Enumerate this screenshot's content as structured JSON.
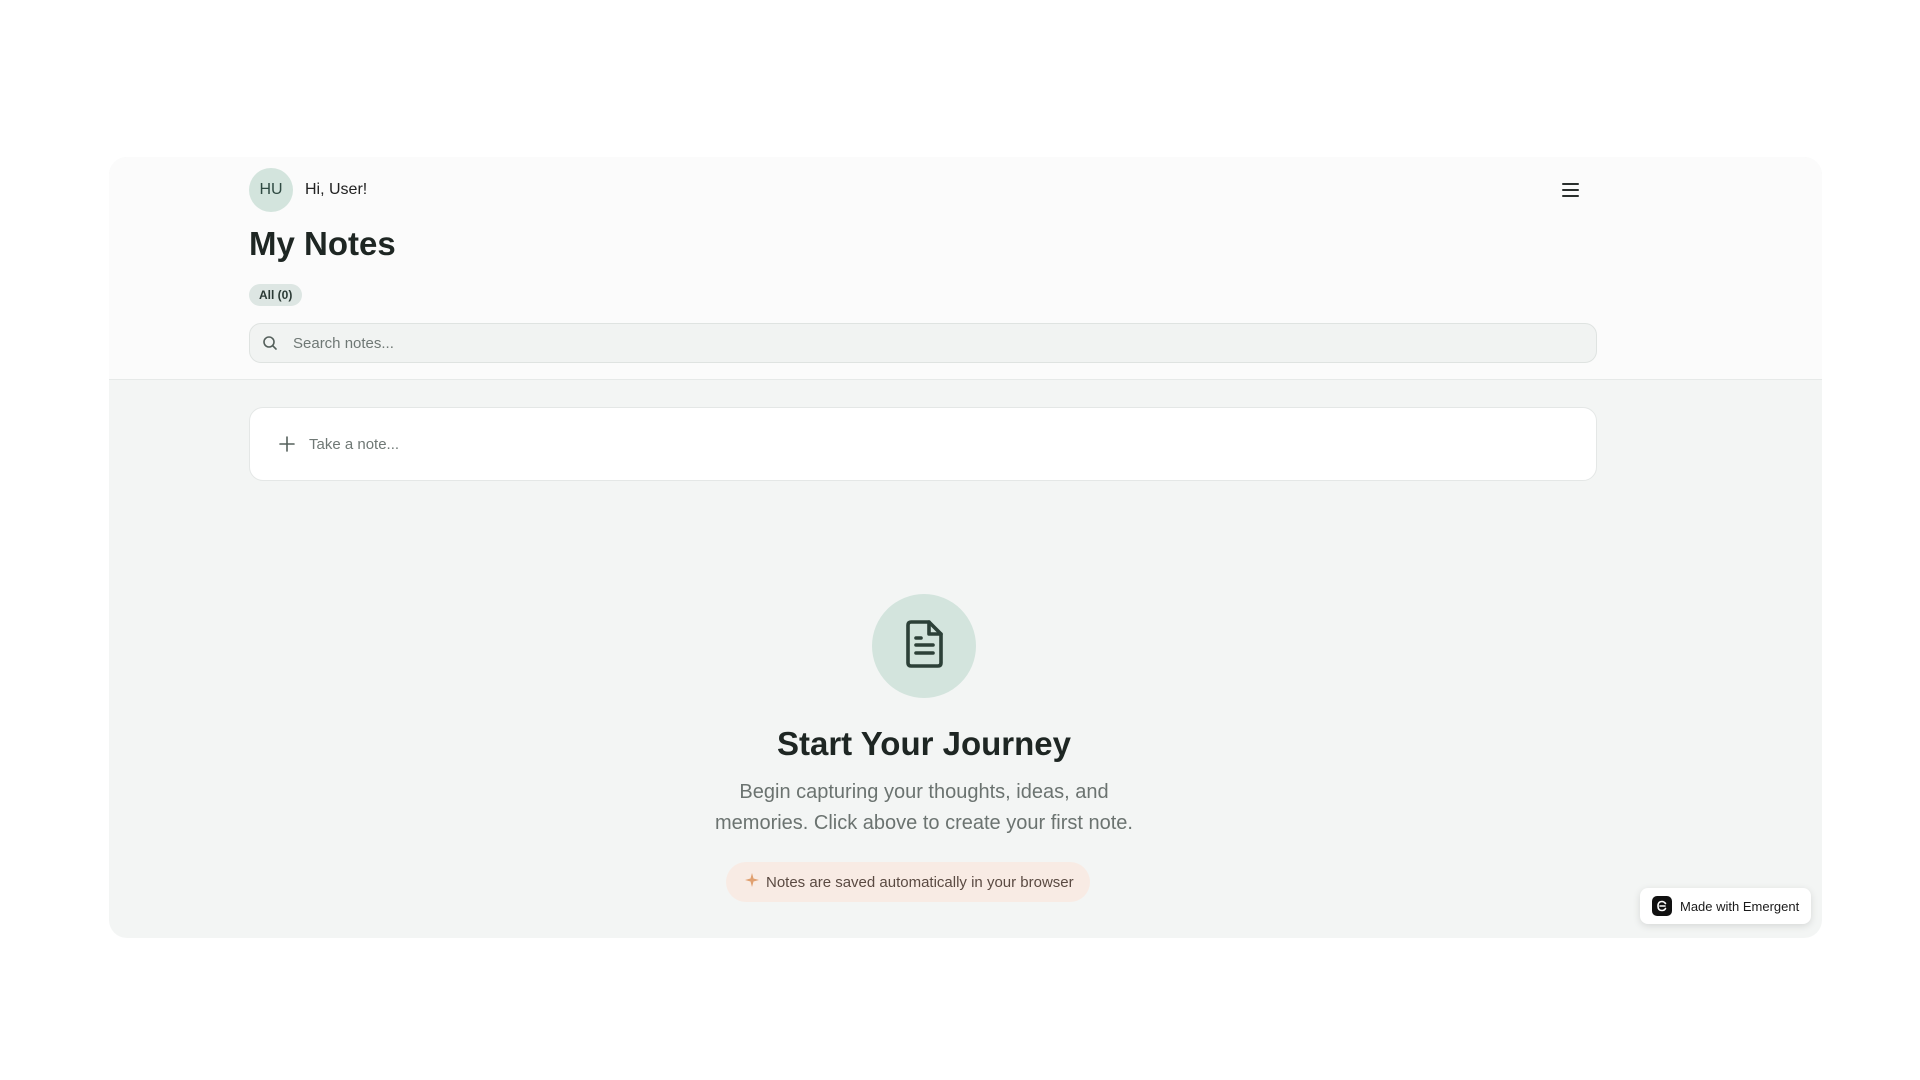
{
  "header": {
    "avatar_initials": "HU",
    "greeting": "Hi, User!",
    "menu_icon": "hamburger-menu-icon",
    "title": "My Notes",
    "filter_chip": "All (0)"
  },
  "search": {
    "placeholder": "Search notes...",
    "value": "",
    "icon": "search-icon"
  },
  "composer": {
    "icon": "plus-icon",
    "placeholder": "Take a note..."
  },
  "empty_state": {
    "icon": "document-icon",
    "title": "Start Your Journey",
    "description": "Begin capturing your thoughts, ideas, and memories. Click above to create your first note.",
    "auto_save_icon": "sparkle-icon",
    "auto_save_text": "Notes are saved automatically in your browser"
  },
  "badge": {
    "icon": "emergent-logo-icon",
    "label": "Made with Emergent"
  },
  "colors": {
    "accent": "#d3e4dd",
    "background": "#f3f5f4",
    "header_background": "#fbfbfb",
    "notice_background": "#f8ebe4",
    "sparkle": "#e0a070"
  }
}
